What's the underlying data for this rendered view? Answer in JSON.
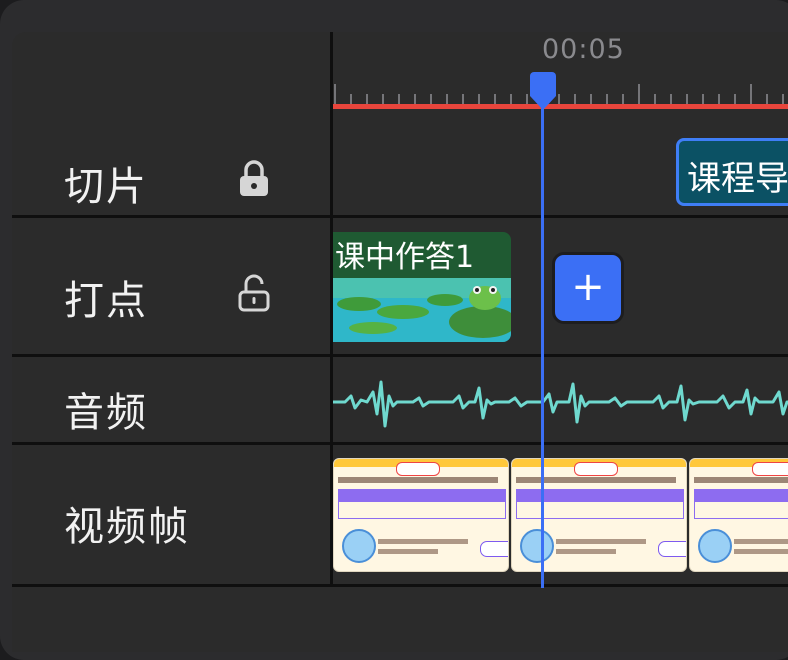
{
  "timeline": {
    "current_time": "00:05",
    "tracks": [
      {
        "label": "切片",
        "locked": true
      },
      {
        "label": "打点",
        "locked": false
      },
      {
        "label": "音频"
      },
      {
        "label": "视频帧"
      }
    ],
    "slice_clip": {
      "label": "课程导"
    },
    "point_clip": {
      "label": "课中作答1"
    },
    "add_point_label": "+"
  },
  "colors": {
    "accent": "#3b6ff5",
    "ruler_line": "#e8453c",
    "waveform": "#6fd9cf",
    "slice_clip_bg": "#0b5164"
  },
  "icons": {
    "locked": "lock-closed-icon",
    "unlocked": "lock-open-icon",
    "add": "plus-icon"
  }
}
